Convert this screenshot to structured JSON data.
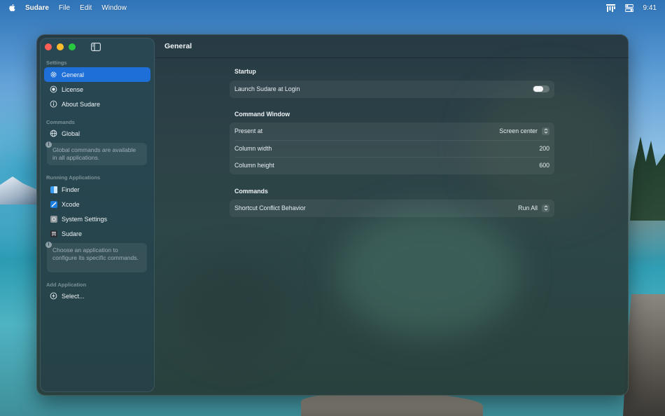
{
  "menubar": {
    "app_name": "Sudare",
    "items": [
      "File",
      "Edit",
      "Window"
    ],
    "time": "9:41"
  },
  "window": {
    "title": "General"
  },
  "sidebar": {
    "sections": {
      "settings": "Settings",
      "commands": "Commands",
      "running": "Running Applications",
      "add": "Add Application"
    },
    "settings_items": [
      {
        "label": "General",
        "icon": "gear-icon"
      },
      {
        "label": "License",
        "icon": "badge-icon"
      },
      {
        "label": "About Sudare",
        "icon": "info-icon"
      }
    ],
    "global": {
      "label": "Global",
      "icon": "globe-icon"
    },
    "global_note": "Global commands are available in all applications.",
    "apps": [
      {
        "label": "Finder",
        "icon": "finder-icon"
      },
      {
        "label": "Xcode",
        "icon": "xcode-icon"
      },
      {
        "label": "System Settings",
        "icon": "system-settings-icon"
      },
      {
        "label": "Sudare",
        "icon": "sudare-icon"
      }
    ],
    "apps_note": "Choose an application to configure its specific commands.",
    "select": {
      "label": "Select...",
      "icon": "plus-circle-icon"
    }
  },
  "main": {
    "startup": {
      "title": "Startup",
      "launch_label": "Launch Sudare at Login",
      "launch_on": false
    },
    "command_window": {
      "title": "Command Window",
      "present_label": "Present at",
      "present_value": "Screen center",
      "width_label": "Column width",
      "width_value": "200",
      "height_label": "Column height",
      "height_value": "600"
    },
    "commands": {
      "title": "Commands",
      "conflict_label": "Shortcut Conflict Behavior",
      "conflict_value": "Run All"
    }
  },
  "colors": {
    "accent": "#1f6fd9",
    "close": "#fe5f57",
    "minimize": "#febc2e",
    "zoom": "#28c840"
  }
}
